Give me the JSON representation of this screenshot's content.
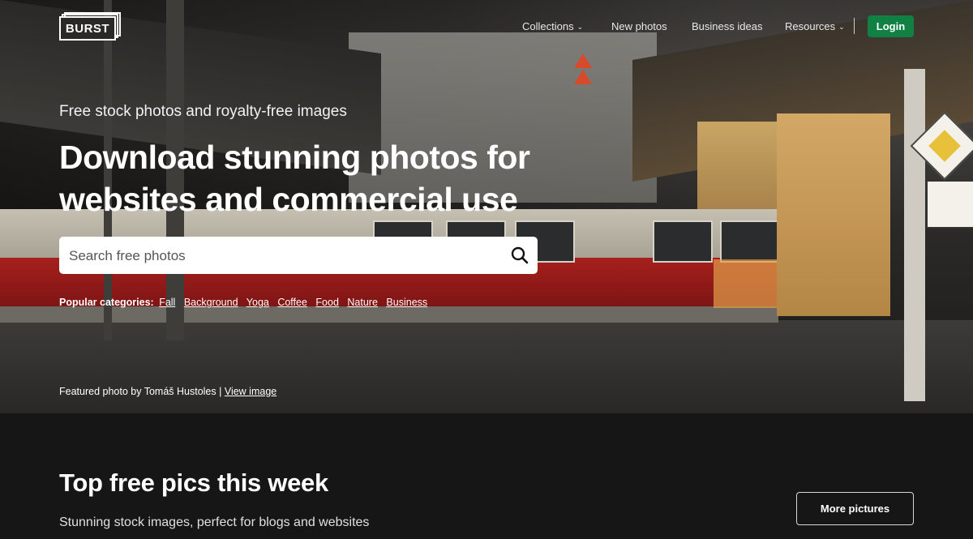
{
  "header": {
    "logo_text": "BURST",
    "nav": [
      {
        "label": "Collections",
        "has_dropdown": true
      },
      {
        "label": "New photos",
        "has_dropdown": false
      },
      {
        "label": "Business ideas",
        "has_dropdown": false
      },
      {
        "label": "Resources",
        "has_dropdown": true
      }
    ],
    "login_label": "Login",
    "login_color": "#108043"
  },
  "hero": {
    "kicker": "Free stock photos and royalty-free images",
    "headline": "Download stunning photos for websites and commercial use",
    "search": {
      "placeholder": "Search free photos",
      "value": "",
      "icon": "search-icon"
    },
    "popular_label": "Popular categories:",
    "categories": [
      "Fall",
      "Background",
      "Yoga",
      "Coffee",
      "Food",
      "Nature",
      "Business"
    ],
    "credit_text": "Featured photo by Tomáš Hustoles |",
    "credit_link": "View image"
  },
  "top_pics": {
    "title": "Top free pics this week",
    "subtitle": "Stunning stock images, perfect for blogs and websites",
    "more_button": "More pictures"
  }
}
